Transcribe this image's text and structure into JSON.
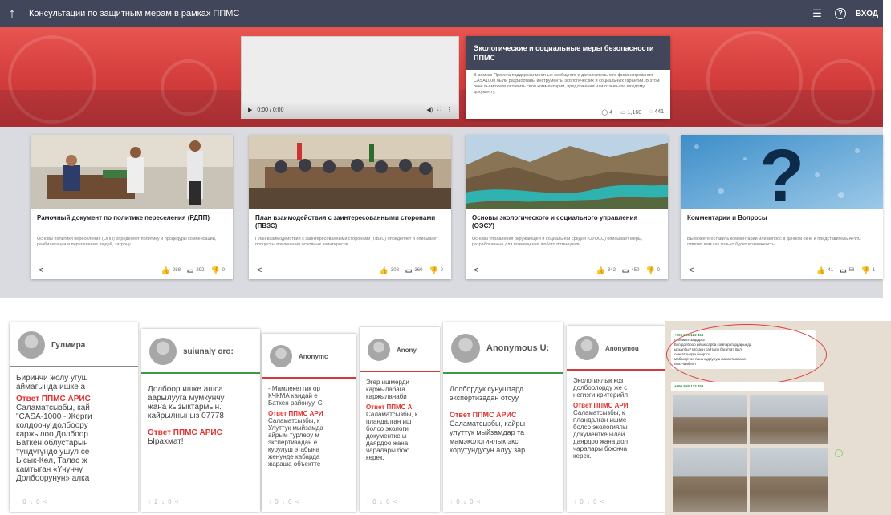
{
  "header": {
    "title": "Консультации по защитным мерам в рамках ППМС",
    "login": "ВХОД"
  },
  "video": {
    "time": "0:00 / 0:00"
  },
  "info_card": {
    "title": "Экологические и социальные меры безопасности ППМС",
    "description": "В рамках Проекта поддержки местных сообществ и дополнительного финансирования CASA1000 были разработаны инструменты экологических и социальных гарантий. В этом окне вы можете оставить свои комментарии, предложения или отзывы по каждому документу.",
    "comments": "4",
    "views": "1,160",
    "likes": "441"
  },
  "cards": [
    {
      "title": "Рамочный документ по политике переселения (РДПП)",
      "desc": "Основы политики переселения (ОПП) определяет политику и процедуры компенсации, реабилитации и переселения людей, затрону...",
      "likes": "288",
      "comments": "292",
      "dislikes": "0"
    },
    {
      "title": "План взаимодействия с заинтересованными сторонами (ПВЗС)",
      "desc": "План взаимодействия с заинтересованными сторонами (ПВЗС) определяет и описывает процессы вовлечения основных заинтересов...",
      "likes": "308",
      "comments": "360",
      "dislikes": "0"
    },
    {
      "title": "Основы экологического и социального управления (ОЭСУ)",
      "desc": "Основы управления окружающей и социальной средой (ОУОСС) описывает меры, разработанные для возмещения любого потенциаль...",
      "likes": "342",
      "comments": "450",
      "dislikes": "0"
    },
    {
      "title": "Комментарии и Вопросы",
      "desc": "Вы можете оставить комментарий или вопрос в данном окне и представитель АРИС ответит вам как только будет возможность.",
      "likes": "41",
      "comments": "58",
      "dislikes": "1"
    }
  ],
  "comments": [
    {
      "name": "Гулмира",
      "text": [
        "Биринчи жолу угуш",
        "аймагында ишке а"
      ],
      "answer": "Ответ ППМС АРИС",
      "answer_text": [
        "Саламатсызбы, кай",
        "\"CASA-1000 - Жерги",
        "колдоочу долбоору",
        "каржылоо Долбоор",
        "Баткен облустарын",
        "түндүгүндө ушул се",
        "Ысык-Көл, Талас ж",
        "камтыган «Үчүнчү",
        "Долбоорунун» алка"
      ],
      "votes": "↑ 0 ↓ 0  <"
    },
    {
      "name": "suiunaly oro:",
      "text": [
        "Долбоор ишке ашса",
        "аарылууга мумкунчу",
        "жана кызыктармын.",
        "кайрылныныз 07778"
      ],
      "answer": "Ответ ППМС АРИС",
      "answer_text": [
        "Ырахмат!"
      ],
      "votes": "↑ 2 ↓ 0  <"
    },
    {
      "name": "Anonymc",
      "text": [
        "- Мамлекеттик ор",
        "КЧКМА кандай е",
        "Баткен районуу. С"
      ],
      "answer": "Ответ ППМС АРИ",
      "answer_text": [
        "Саламатсызбы, к",
        "Улуттук мыйзамда",
        "айрым турлеру м",
        "экспертизадан е",
        "курулуш этабына",
        "женунде кабарда",
        "жараша объектте"
      ],
      "votes": "↑ 0 ↓ 0  <"
    },
    {
      "name": "Anony",
      "text": [
        "Эгер ишмерди",
        "каржылабага",
        "каржыланаби"
      ],
      "answer": "Ответ ППМС А",
      "answer_text": [
        "Саламатсызбы, к",
        "пландалган иш",
        "болсо экологи",
        "документке ы",
        "даярдоо жана",
        "чаралары бою",
        "керек."
      ],
      "votes": "↑ 0 ↓ 0  <"
    },
    {
      "name": "Anonymous U:",
      "text": [
        "Долбордук сунуштард",
        "экспертизадан отсуу"
      ],
      "answer": "Ответ ППМС АРИС",
      "answer_text": [
        "Саламатсызбы, кайры",
        "улуттук мыйзамдар та",
        "мамэкологиялык экс",
        "корутундусун алуу зар"
      ],
      "votes": "↑ 0 ↓ 0  <"
    },
    {
      "name": "Anonymou",
      "text": [
        "Экологиялык коз",
        "долборлорду же с",
        "негизги критерийл"
      ],
      "answer": "Ответ ППМС АРИ",
      "answer_text": [
        "Саламатсызбы, к",
        "пландалган ишме",
        "болсо экологиялы",
        "документке ылай",
        "даярдоо жана дол",
        "чаралары боюнча",
        "керек."
      ],
      "votes": "↑ 0 ↓ 0  <"
    }
  ],
  "whatsapp": {
    "phone": "+996 555 123 456",
    "msg1": [
      "Саламатсыздары!",
      "Бул долбоор ыйык сарба компаратардарында",
      "ыскалбы? Ыскасн сайтагы багатта? Бул",
      "сенкатчыдан боортоо ...",
      "мабакорчоо пана кудрулуш мапастаомана",
      "поатчаабелп"
    ],
    "msg2": "+996 555 123 456"
  }
}
